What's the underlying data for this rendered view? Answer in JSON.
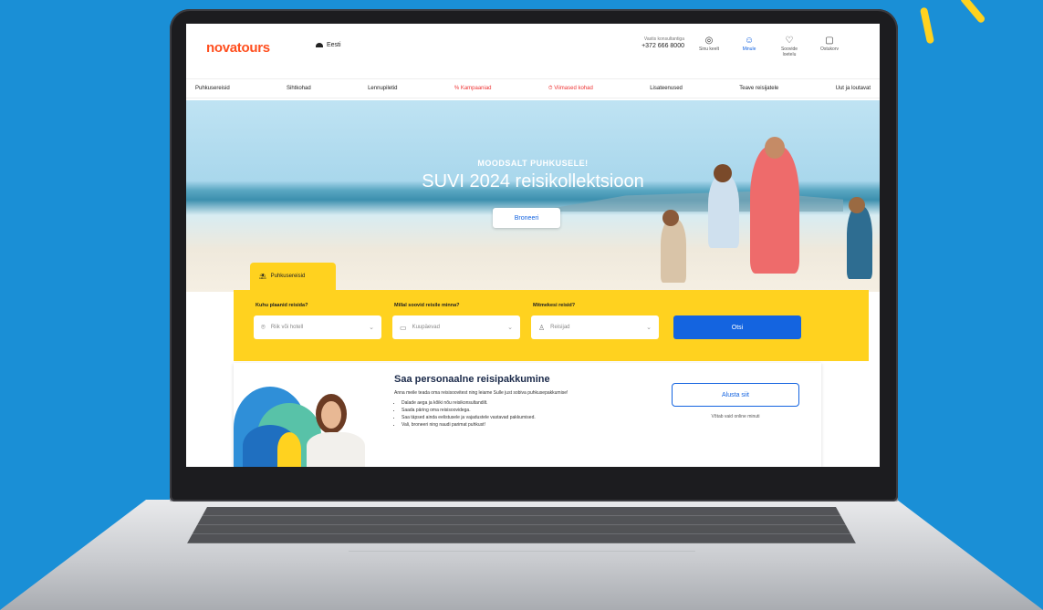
{
  "header": {
    "logo": "novatours",
    "language": "Eesti",
    "phone_label": "Vastis konsultantiga",
    "phone": "+372 666 8000",
    "icons": [
      {
        "label": "Sinu keelt",
        "icon": "globe-icon"
      },
      {
        "label": "Minule",
        "icon": "user-icon"
      },
      {
        "label": "Soovide loetelu",
        "icon": "heart-icon"
      },
      {
        "label": "Ostukorv",
        "icon": "bag-icon"
      }
    ]
  },
  "nav": {
    "items": [
      "Puhkusereisid",
      "Sihtkohad",
      "Lennupiletid",
      "% Kampaaniad",
      "⏱ Viimased kohad",
      "Lisateenused",
      "Teave reisijatele",
      "Uut ja loutavat"
    ]
  },
  "hero": {
    "subtitle": "MOODSALT PUHKUSELE!",
    "title": "SUVI 2024 reisikollektsioon",
    "button": "Broneeri"
  },
  "search": {
    "tab_label": "Puhkusereisid",
    "where_label": "Kuhu plaanid reisida?",
    "where_placeholder": "Riik või hotell",
    "when_label": "Millal soovid reisile minna?",
    "when_placeholder": "Kuupäevad",
    "who_label": "Mitmekesi reisid?",
    "who_placeholder": "Reisijad",
    "search_button": "Otsi"
  },
  "promo": {
    "title": "Saa personaalne reisipakkumine",
    "description": "Anna meile teada oma reisisoovitest ning leiame Sulle just sobiva puhkusepakkumise!",
    "bullets": [
      "Dalade aega ja kõiki nõu reisikonsultandilt.",
      "Saada päring oma reisisoovidega.",
      "Saa täpsed ainda eelistusele ja vajadustele vastavad pakkumised.",
      "Vali, broneeri ning naudi parimat puhkust!"
    ],
    "button": "Alusta siit",
    "note": "Võtab vaid online minuti"
  },
  "colors": {
    "background": "#1a8fd6",
    "accent_yellow": "#ffd21f",
    "primary_blue": "#1464e0",
    "logo_orange": "#ff4f1f"
  }
}
